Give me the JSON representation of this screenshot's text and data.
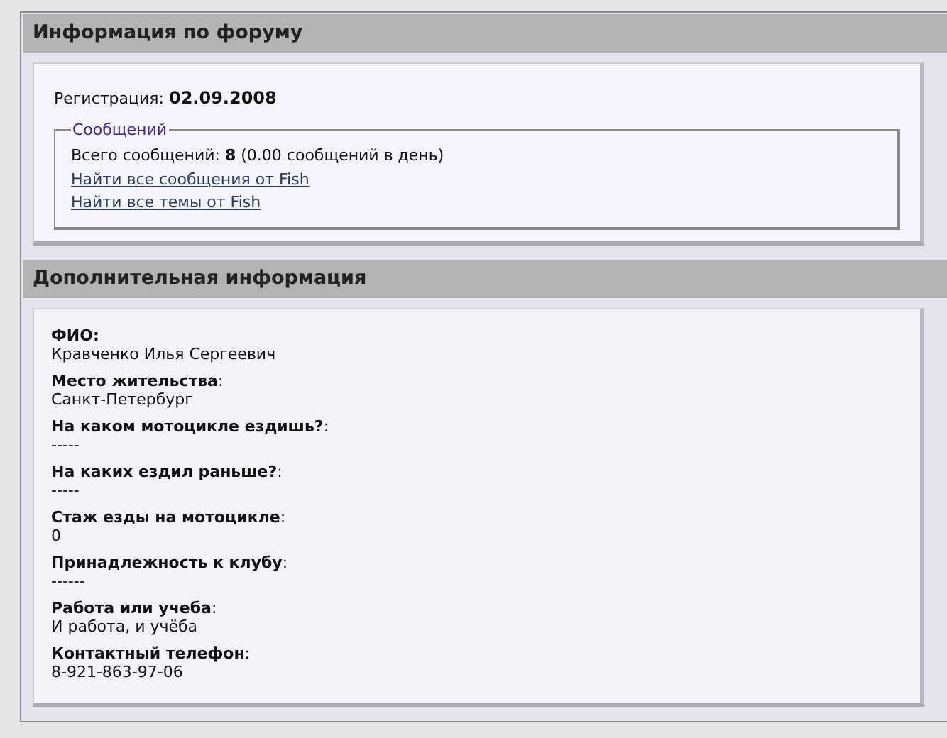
{
  "forum_info": {
    "title": "Информация по форуму",
    "registration": {
      "label": "Регистрация:",
      "value": "02.09.2008"
    },
    "messages": {
      "legend": "Сообщений",
      "total": "Всего сообщений: **8** (0.00 сообщений в день)",
      "links": [
        "Найти все сообщения от Fish",
        "Найти все темы от Fish"
      ]
    }
  },
  "extra_info": {
    "title": "Дополнительная информация",
    "fields": [
      {
        "label": "**ФИО:**",
        "value": "Кравченко Илья Сергеевич"
      },
      {
        "label": "**Место жительства**:",
        "value": "Санкт-Петербург"
      },
      {
        "label": "**На каком мотоцикле ездишь?**:",
        "value": "-----"
      },
      {
        "label": "**На каких ездил раньше?**:",
        "value": "-----"
      },
      {
        "label": "**Стаж езды на мотоцикле**:",
        "value": "0"
      },
      {
        "label": "**Принадлежность к клубу**:",
        "value": "------"
      },
      {
        "label": "**Работа или учеба**:",
        "value": "И работа, и учёба"
      },
      {
        "label": "**Контактный телефон**:",
        "value": "8-921-863-97-06"
      }
    ]
  }
}
